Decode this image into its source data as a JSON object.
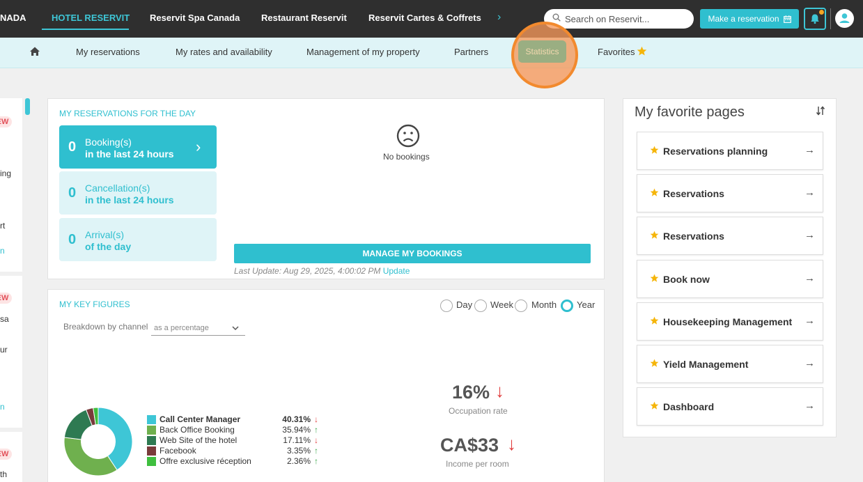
{
  "topnav": {
    "brand_cut": "NADA",
    "items": [
      "HOTEL RESERVIT",
      "Reservit Spa Canada",
      "Restaurant Reservit",
      "Reservit Cartes & Coffrets"
    ],
    "more_icon": "chevron-right-icon",
    "search_placeholder": "Search on Reservit...",
    "make_reservation": "Make a reservation"
  },
  "subnav": {
    "items": [
      "My reservations",
      "My rates and availability",
      "Management of my property",
      "Partners",
      "Statistics",
      "Favorites"
    ]
  },
  "left_strip": {
    "badge": "EW",
    "texts": [
      "ing",
      "rt",
      "sa",
      "ur",
      "th"
    ]
  },
  "reservations": {
    "title": "MY RESERVATIONS FOR THE DAY",
    "cards": [
      {
        "count": "0",
        "line1": "Booking(s)",
        "line2": "in the last 24 hours"
      },
      {
        "count": "0",
        "line1": "Cancellation(s)",
        "line2": "in the last 24 hours"
      },
      {
        "count": "0",
        "line1": "Arrival(s)",
        "line2": "of the day"
      }
    ],
    "empty_text": "No bookings",
    "manage_button": "MANAGE MY BOOKINGS",
    "last_update": "Last Update: Aug 29, 2025, 4:00:02 PM",
    "update_link": "Update"
  },
  "key_figures": {
    "title": "MY KEY FIGURES",
    "periods": [
      "Day",
      "Week",
      "Month",
      "Year"
    ],
    "selected_period": "Year",
    "breakdown_label": "Breakdown by channel",
    "breakdown_value": "as a percentage",
    "channels": [
      {
        "name": "Call Center Manager",
        "pct": "40.31%",
        "trend": "down",
        "color": "#3ec6d6"
      },
      {
        "name": "Back Office Booking",
        "pct": "35.94%",
        "trend": "up",
        "color": "#6fb04e"
      },
      {
        "name": "Web Site of the hotel",
        "pct": "17.11%",
        "trend": "down",
        "color": "#2e7a52"
      },
      {
        "name": "Facebook",
        "pct": "3.35%",
        "trend": "up",
        "color": "#7a3b3b"
      },
      {
        "name": "Offre exclusive réception",
        "pct": "2.36%",
        "trend": "up",
        "color": "#3fbf3f"
      }
    ],
    "occupation_value": "16%",
    "occupation_label": "Occupation rate",
    "income_value": "CA$33",
    "income_label": "Income per room"
  },
  "favorites": {
    "title": "My favorite pages",
    "items": [
      "Reservations planning",
      "Reservations",
      "Reservations",
      "Book now",
      "Housekeeping Management",
      "Yield Management",
      "Dashboard"
    ]
  },
  "colors": {
    "accent": "#2fbfcf",
    "topbar": "#2f2f2f",
    "subnav": "#dff4f7",
    "highlight": "#f28a2e",
    "down": "#e03c3c",
    "up": "#3aa84a"
  }
}
